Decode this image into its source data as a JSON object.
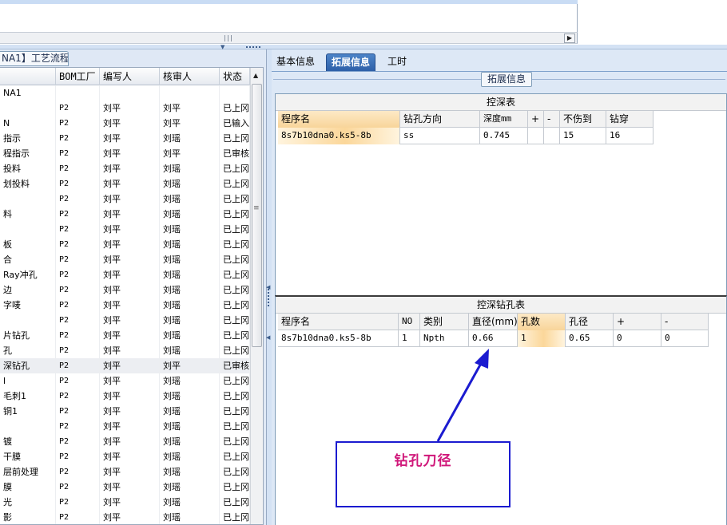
{
  "left_panel": {
    "tab_label": "NA1】工艺流程",
    "columns": [
      "",
      "BOM工厂",
      "编写人",
      "核审人",
      "状态"
    ],
    "rows": [
      [
        "NA1",
        "",
        "",
        "",
        ""
      ],
      [
        "",
        "P2",
        "刘平",
        "刘平",
        "已上冈"
      ],
      [
        "N",
        "P2",
        "刘平",
        "刘平",
        "已输入"
      ],
      [
        "指示",
        "P2",
        "刘平",
        "刘瑶",
        "已上冈"
      ],
      [
        "程指示",
        "P2",
        "刘平",
        "刘平",
        "已审核"
      ],
      [
        "投料",
        "P2",
        "刘平",
        "刘瑶",
        "已上冈"
      ],
      [
        "划投料",
        "P2",
        "刘平",
        "刘瑶",
        "已上冈"
      ],
      [
        "",
        "P2",
        "刘平",
        "刘瑶",
        "已上冈"
      ],
      [
        "料",
        "P2",
        "刘平",
        "刘瑶",
        "已上冈"
      ],
      [
        "",
        "P2",
        "刘平",
        "刘瑶",
        "已上冈"
      ],
      [
        "板",
        "P2",
        "刘平",
        "刘瑶",
        "已上冈"
      ],
      [
        "合",
        "P2",
        "刘平",
        "刘瑶",
        "已上冈"
      ],
      [
        "Ray冲孔",
        "P2",
        "刘平",
        "刘瑶",
        "已上冈"
      ],
      [
        "边",
        "P2",
        "刘平",
        "刘瑶",
        "已上冈"
      ],
      [
        "字唛",
        "P2",
        "刘平",
        "刘瑶",
        "已上冈"
      ],
      [
        "",
        "P2",
        "刘平",
        "刘瑶",
        "已上冈"
      ],
      [
        "片钻孔",
        "P2",
        "刘平",
        "刘瑶",
        "已上冈"
      ],
      [
        "孔",
        "P2",
        "刘平",
        "刘瑶",
        "已上冈"
      ],
      [
        "深钻孔",
        "P2",
        "刘平",
        "刘平",
        "已审核"
      ],
      [
        "l",
        "P2",
        "刘平",
        "刘瑶",
        "已上冈"
      ],
      [
        "毛刺1",
        "P2",
        "刘平",
        "刘瑶",
        "已上冈"
      ],
      [
        "铜1",
        "P2",
        "刘平",
        "刘瑶",
        "已上冈"
      ],
      [
        "",
        "P2",
        "刘平",
        "刘瑶",
        "已上冈"
      ],
      [
        "镀",
        "P2",
        "刘平",
        "刘瑶",
        "已上冈"
      ],
      [
        "干膜",
        "P2",
        "刘平",
        "刘瑶",
        "已上冈"
      ],
      [
        "层前处理",
        "P2",
        "刘平",
        "刘瑶",
        "已上冈"
      ],
      [
        "膜",
        "P2",
        "刘平",
        "刘瑶",
        "已上冈"
      ],
      [
        "光",
        "P2",
        "刘平",
        "刘瑶",
        "已上冈"
      ],
      [
        "影",
        "P2",
        "刘平",
        "刘瑶",
        "已上冈"
      ]
    ],
    "selected_row": 18
  },
  "tabs": [
    "基本信息",
    "拓展信息",
    "工时"
  ],
  "active_tab": 1,
  "group_title": "拓展信息",
  "table1": {
    "title": "控深表",
    "columns": [
      "程序名",
      "钻孔方向",
      "深度mm",
      "+",
      "-",
      "不伤到",
      "钻穿"
    ],
    "row": [
      "8s7b10dna0.ks5-8b",
      "ss",
      "0.745",
      "",
      "",
      "15",
      "16"
    ]
  },
  "table2": {
    "title": "控深钻孔表",
    "columns": [
      "程序名",
      "NO",
      "类别",
      "直径(mm)",
      "孔数",
      "孔径",
      "+",
      "-"
    ],
    "row": [
      "8s7b10dna0.ks5-8b",
      "1",
      "Npth",
      "0.66",
      "1",
      "0.65",
      "0",
      "0"
    ]
  },
  "annotation": {
    "text": "钻孔刀径",
    "border_color": "#1b1bd0",
    "text_color": "#d0187a"
  }
}
